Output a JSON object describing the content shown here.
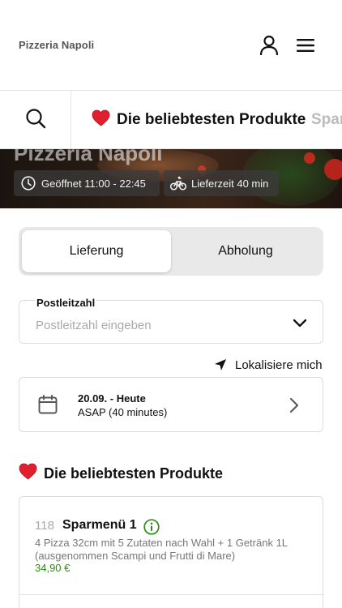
{
  "header": {
    "brand": "Pizzeria Napoli"
  },
  "category_bar": {
    "active": "Die beliebtesten Produkte",
    "next": "Spar"
  },
  "hero": {
    "title": "Pizzeria Napoli",
    "opening": "Geöffnet 11:00 - 22:45",
    "delivery_time": "Lieferzeit 40 min"
  },
  "order_mode": {
    "delivery": "Lieferung",
    "pickup": "Abholung",
    "selected": "Lieferung"
  },
  "postcode": {
    "label": "Postleitzahl",
    "placeholder": "Postleitzahl eingeben",
    "value": ""
  },
  "locate": {
    "label": "Lokalisiere mich"
  },
  "schedule": {
    "date": "20.09. - Heute",
    "time": "ASAP (40 minutes)"
  },
  "section": {
    "title": "Die beliebtesten Produkte"
  },
  "products": [
    {
      "number": "118",
      "name": "Sparmenü 1",
      "description": "4 Pizza 32cm mit 5 Zutaten nach Wahl + 1 Getränk 1L (ausgenommen Scampi und Frutti di Mare)",
      "price": "34,90 €"
    }
  ],
  "colors": {
    "price_green": "#2e8b14",
    "info_green": "#2e8b14",
    "heart_red": "#e0202e"
  },
  "icons": {
    "user": "user-icon",
    "menu": "hamburger-menu-icon",
    "search": "search-icon",
    "heart": "heart-icon",
    "clock": "clock-icon",
    "bike": "bike-icon",
    "chevron_down": "chevron-down-icon",
    "location": "location-arrow-icon",
    "calendar": "calendar-icon",
    "chevron_right": "chevron-right-icon",
    "info": "info-icon"
  }
}
